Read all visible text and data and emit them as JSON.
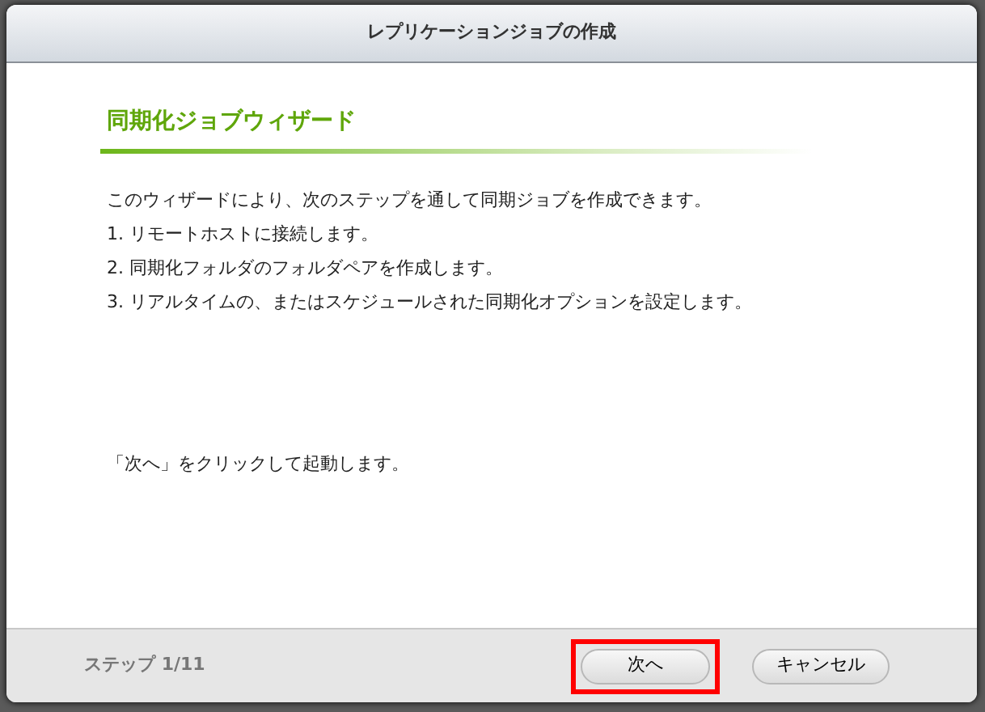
{
  "window": {
    "title": "レプリケーションジョブの作成"
  },
  "wizard": {
    "heading": "同期化ジョブウィザード",
    "intro": "このウィザードにより、次のステップを通して同期ジョブを作成できます。",
    "steps": [
      "1. リモートホストに接続します。",
      "2. 同期化フォルダのフォルダペアを作成します。",
      "3. リアルタイムの、またはスケジュールされた同期化オプションを設定します。"
    ],
    "hint": "「次へ」をクリックして起動します。"
  },
  "footer": {
    "step": "ステップ 1/11",
    "buttons": [
      {
        "label": "次へ",
        "highlighted": true
      },
      {
        "label": "キャンセル",
        "highlighted": false
      }
    ]
  }
}
